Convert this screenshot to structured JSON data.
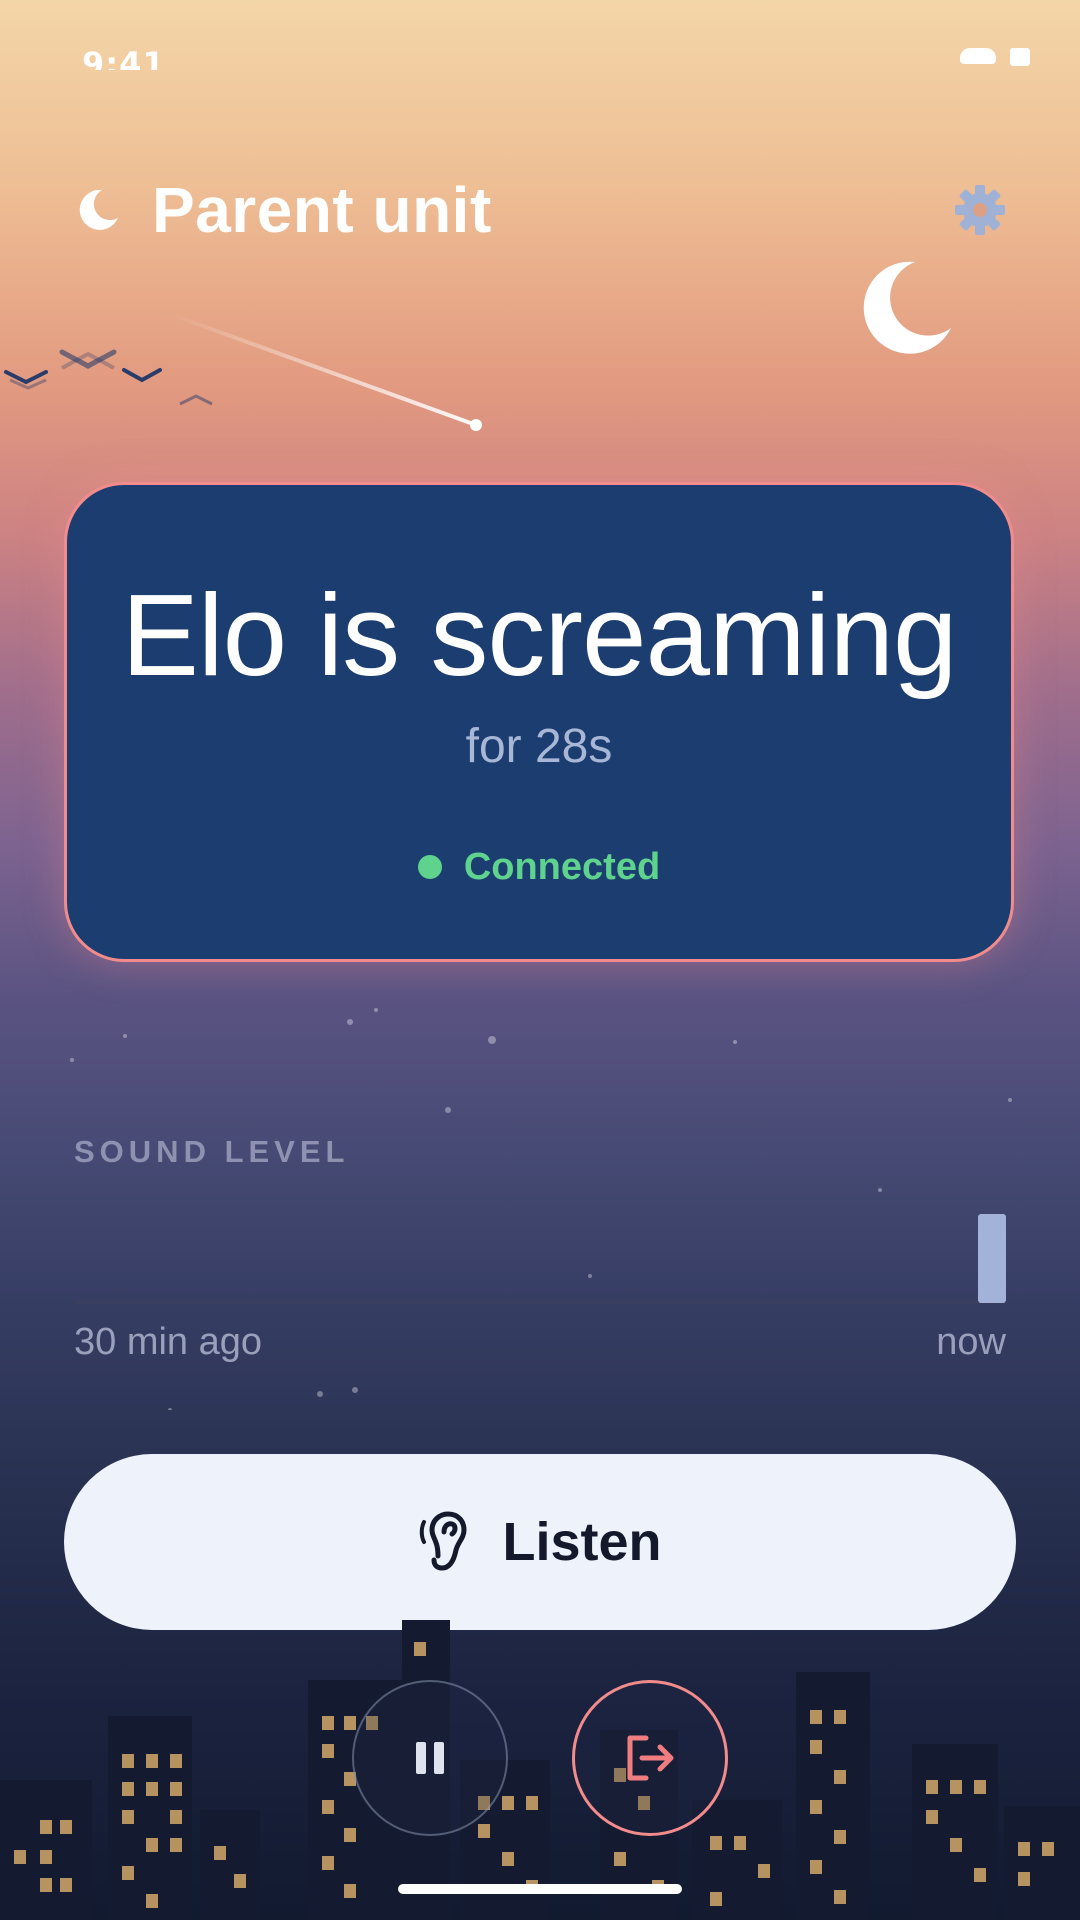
{
  "status_bar": {
    "time": "9:41"
  },
  "header": {
    "title": "Parent unit",
    "settings_icon": "gear-icon",
    "title_icon": "moon-icon"
  },
  "status_card": {
    "message": "Elo is screaming",
    "duration": "for 28s",
    "connection": "Connected"
  },
  "sound_level": {
    "heading": "SOUND LEVEL",
    "axis_start": "30 min ago",
    "axis_end": "now",
    "current_level": 0.89
  },
  "actions": {
    "listen_label": "Listen",
    "listen_icon": "ear-icon",
    "pause_icon": "pause-icon",
    "exit_icon": "exit-icon"
  },
  "colors": {
    "card_background": "#1c3d70",
    "card_border": "#f28c8c",
    "connected": "#5fd38d",
    "listen_button": "#eef2fb"
  }
}
